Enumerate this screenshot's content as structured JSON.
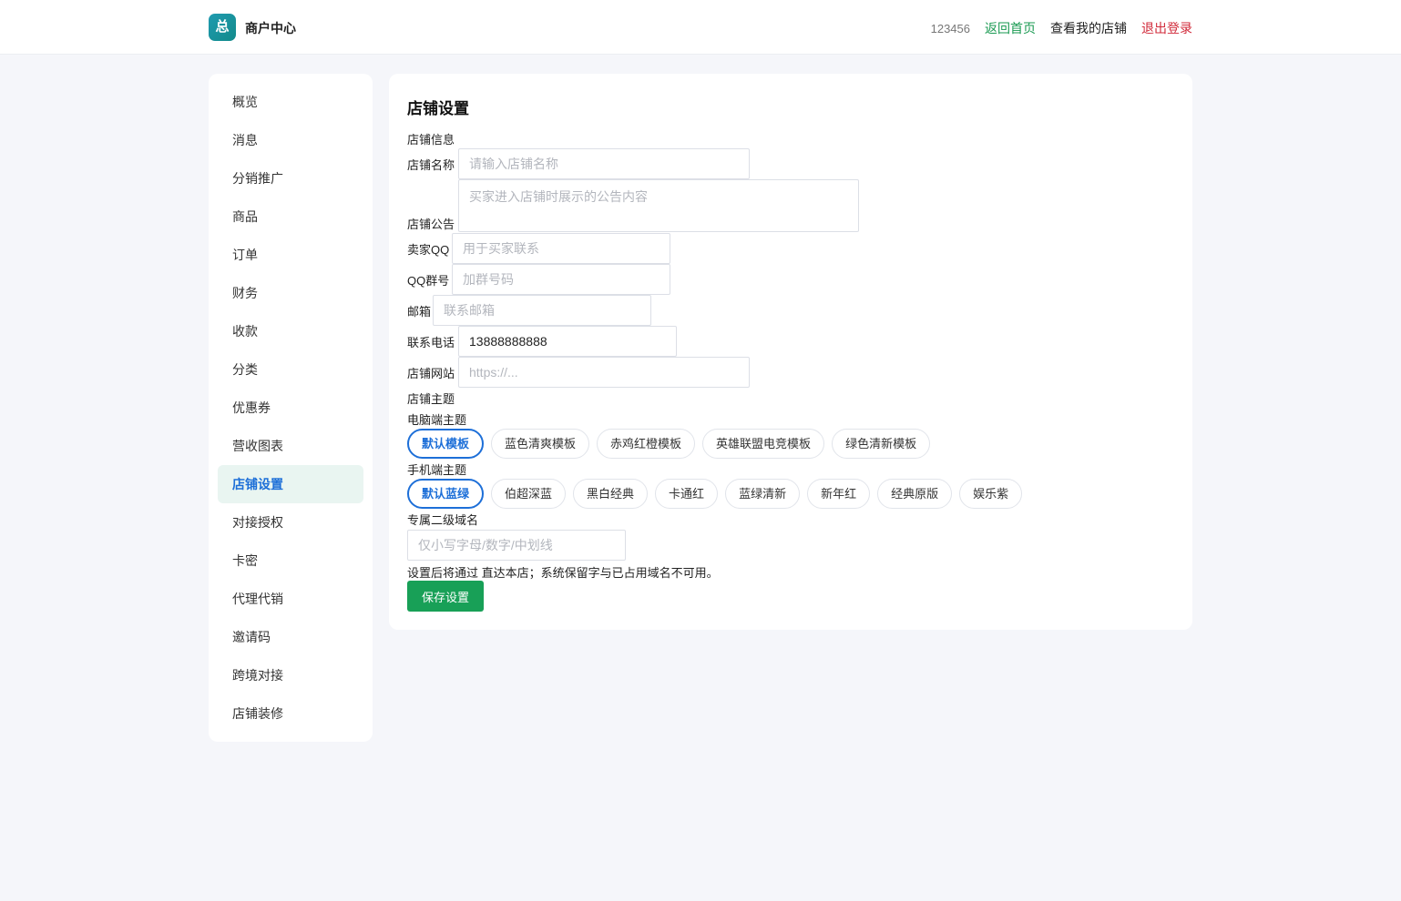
{
  "header": {
    "logo_text": "总",
    "brand": "商户中心",
    "user_id": "123456",
    "home_link": "返回首页",
    "store_link": "查看我的店铺",
    "logout_link": "退出登录"
  },
  "sidebar": {
    "items": [
      "概览",
      "消息",
      "分销推广",
      "商品",
      "订单",
      "财务",
      "收款",
      "分类",
      "优惠券",
      "营收图表",
      "店铺设置",
      "对接授权",
      "卡密",
      "代理代销",
      "邀请码",
      "跨境对接",
      "店铺装修"
    ],
    "active": "店铺设置"
  },
  "panel": {
    "title": "店铺设置",
    "section_info": "店铺信息",
    "fields": {
      "name": {
        "label": "店铺名称",
        "value": "",
        "placeholder": "请输入店铺名称"
      },
      "notice": {
        "label": "店铺公告",
        "value": "",
        "placeholder": "买家进入店铺时展示的公告内容"
      },
      "qq": {
        "label": "卖家QQ",
        "value": "",
        "placeholder": "用于买家联系"
      },
      "qq_group": {
        "label": "QQ群号",
        "value": "",
        "placeholder": "加群号码"
      },
      "email": {
        "label": "邮箱",
        "value": "",
        "placeholder": "联系邮箱"
      },
      "phone": {
        "label": "联系电话",
        "value": "13888888888",
        "placeholder": ""
      },
      "website": {
        "label": "店铺网站",
        "value": "",
        "placeholder": "https://..."
      }
    },
    "section_theme": "店铺主题",
    "pc_theme": {
      "label": "电脑端主题",
      "options": [
        "默认模板",
        "蓝色清爽模板",
        "赤鸡红橙模板",
        "英雄联盟电竞模板",
        "绿色清新模板"
      ],
      "selected": "默认模板"
    },
    "mobile_theme": {
      "label": "手机端主题",
      "options": [
        "默认蓝绿",
        "伯超深蓝",
        "黑白经典",
        "卡通红",
        "蓝绿清新",
        "新年红",
        "经典原版",
        "娱乐紫"
      ],
      "selected": "默认蓝绿"
    },
    "subdomain": {
      "label": "专属二级域名",
      "value": "",
      "placeholder": "仅小写字母/数字/中划线"
    },
    "note": "设置后将通过 直达本店；系统保留字与已占用域名不可用。",
    "save_label": "保存设置"
  },
  "colors": {
    "accent_green": "#18a057",
    "accent_blue": "#1d6fd8",
    "logout_red": "#d12a3a"
  }
}
